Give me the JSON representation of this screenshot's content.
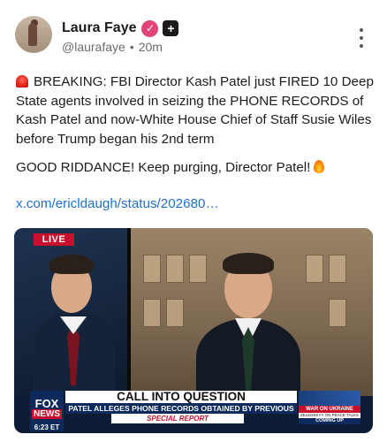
{
  "author": {
    "name": "Laura Faye",
    "handle": "@laurafaye",
    "separator": "•",
    "time": "20m",
    "verified_icon": "checkmark-badge-icon",
    "plus_icon": "plus-badge-icon",
    "verified_symbol": "✓",
    "plus_symbol": "+"
  },
  "post": {
    "paragraph1": "BREAKING: FBI Director Kash Patel just FIRED 10 Deep State agents involved in seizing the PHONE RECORDS of Kash Patel and now-White House Chief of Staff Susie Wiles before Trump began his 2nd term",
    "paragraph2": "GOOD RIDDANCE! Keep purging, Director Patel!",
    "link": "x.com/ericldaugh/status/202680…"
  },
  "media": {
    "live_label": "LIVE",
    "network_logo_top": "FOX",
    "network_logo_bottom": "NEWS",
    "clock": "6:23 ET",
    "headline": "CALL INTO QUESTION",
    "subheadline": "PATEL ALLEGES PHONE RECORDS OBTAINED BY PREVIOUS FBI",
    "special_report": "SPECIAL REPORT",
    "side_title": "WAR ON UKRAINE",
    "side_sub": "ZELENSKYY ON PEACE TALKS",
    "side_coming": "COMING UP"
  },
  "colors": {
    "link": "#1f6fd1",
    "verified": "#e0447a",
    "live": "#c8102e",
    "fox_blue": "#0d2a5c"
  }
}
